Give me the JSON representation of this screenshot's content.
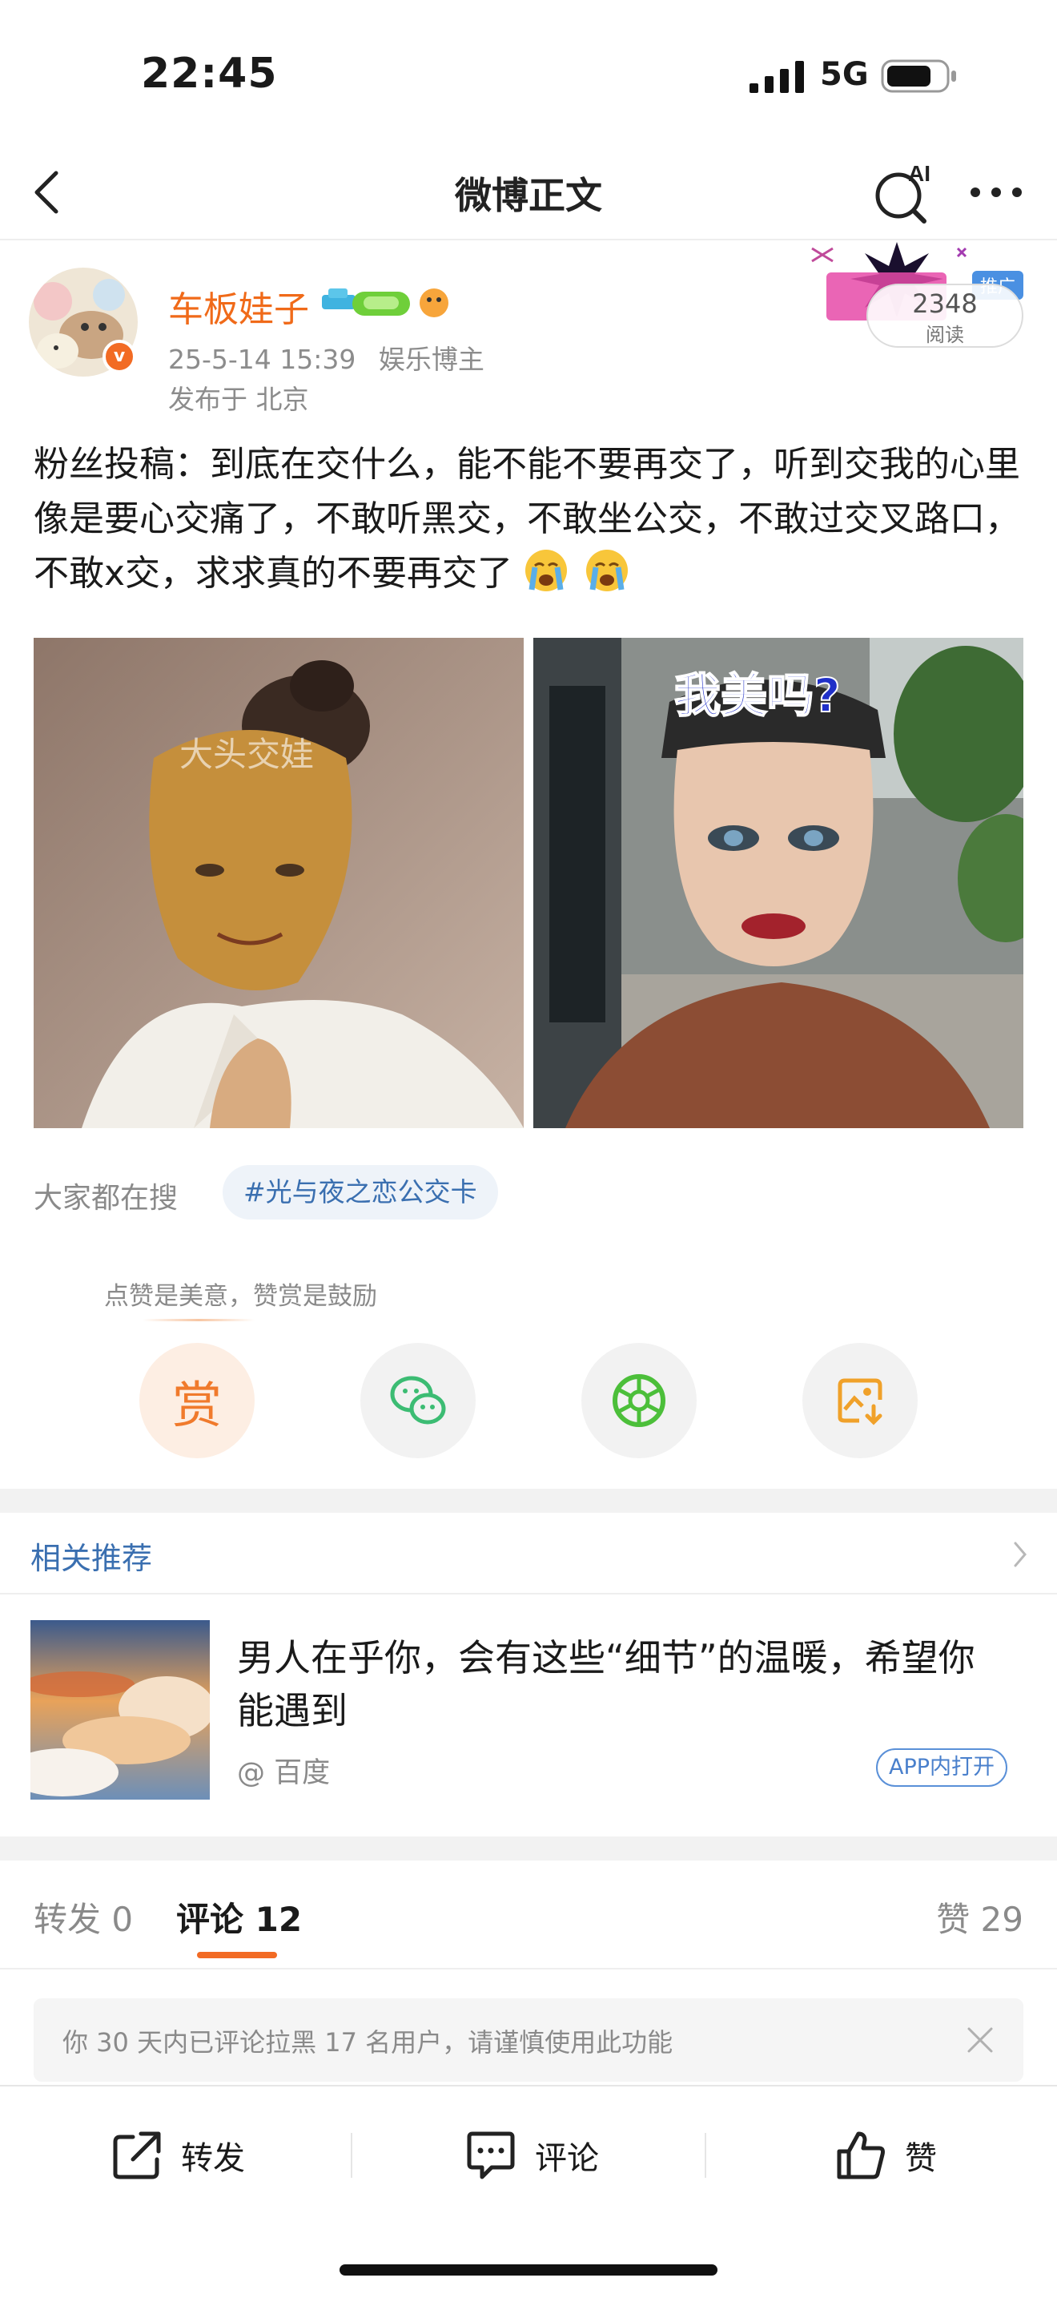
{
  "status_bar": {
    "time": "22:45",
    "network": "5G"
  },
  "nav": {
    "title": "微博正文",
    "ai_label": "AI"
  },
  "post": {
    "author": "车板娃子",
    "verified_mark": "v",
    "date": "25-5-14 15:39",
    "author_tag": "娱乐博主",
    "location": "发布于 北京",
    "promo_label": "推广",
    "read_count": "2348",
    "read_label": "阅读",
    "text": "粉丝投稿：到底在交什么，能不能不要再交了，听到交我的心里像是要心交痛了，不敢听黑交，不敢坐公交，不敢过交叉路口，不敢x交，求求真的不要再交了",
    "trailing_emojis": [
      "crying-emoji",
      "crying-emoji"
    ],
    "images": [
      {
        "caption": "大头交娃"
      },
      {
        "caption": "我美吗?"
      }
    ]
  },
  "search": {
    "label": "大家都在搜",
    "tag": "#光与夜之恋公交卡"
  },
  "reward": {
    "tip": "点赞是美意，赞赏是鼓励",
    "reward_glyph": "赏",
    "actions": [
      "reward-icon",
      "wechat-icon",
      "moments-icon",
      "save-image-icon"
    ]
  },
  "related": {
    "title": "相关推荐",
    "headline": "男人在乎你，会有这些“细节”的温暖，希望你能遇到",
    "source": "@ 百度",
    "open_label": "APP内打开"
  },
  "tabs": {
    "repost": "转发 0",
    "comment": "评论 12",
    "like": "赞 29"
  },
  "notice": {
    "text": "你 30 天内已评论拉黑 17 名用户，请谨慎使用此功能"
  },
  "bottom_bar": {
    "repost": "转发",
    "comment": "评论",
    "like": "赞"
  },
  "colors": {
    "accent": "#f26b24",
    "link": "#3a6fb0",
    "username": "#f06a19"
  }
}
